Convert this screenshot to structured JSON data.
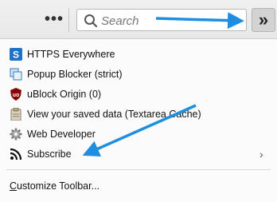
{
  "toolbar": {
    "more_label": "•••",
    "search_placeholder": "Search",
    "overflow_label": "»"
  },
  "menu": {
    "items": [
      {
        "label": "HTTPS Everywhere",
        "icon": "https-everywhere-icon"
      },
      {
        "label": "Popup Blocker (strict)",
        "icon": "popup-blocker-icon"
      },
      {
        "label": "uBlock Origin (0)",
        "icon": "ublock-origin-icon"
      },
      {
        "label": "View your saved data (Textarea Cache)",
        "icon": "textarea-cache-icon"
      },
      {
        "label": "Web Developer",
        "icon": "gear-icon"
      },
      {
        "label": "Subscribe",
        "icon": "rss-icon",
        "has_submenu": true,
        "submenu_indicator": "›"
      }
    ],
    "customize_prefix": "C",
    "customize_rest": "ustomize Toolbar..."
  },
  "colors": {
    "annotation_arrow": "#1f8ee0",
    "https_blue": "#1e73c8",
    "ublock_red": "#8b0000"
  }
}
